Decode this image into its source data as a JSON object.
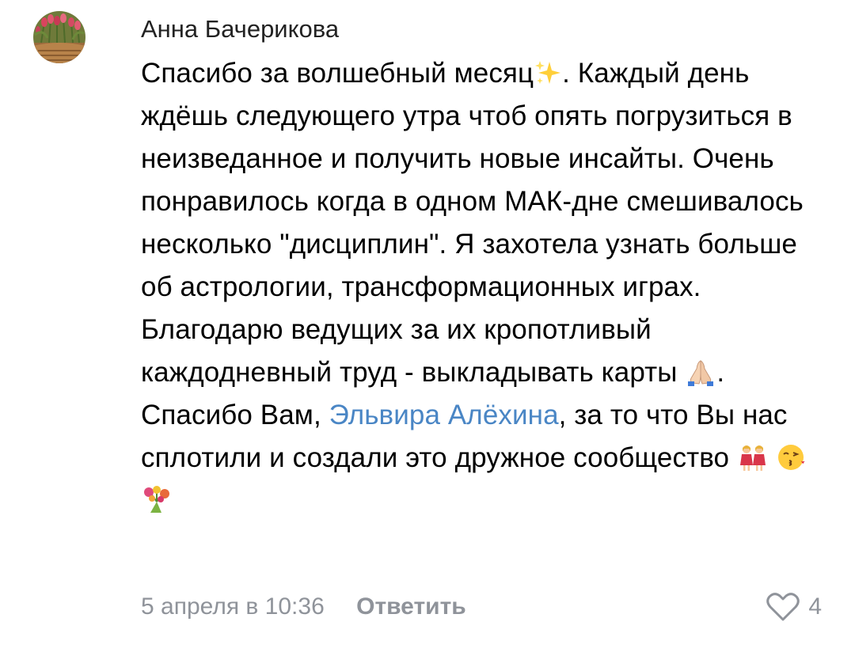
{
  "comment": {
    "author": "Анна Бачерикова",
    "avatar_icon": "tulips-avatar",
    "text": {
      "p1": "Спасибо за волшебный месяц",
      "p2": ". Каждый день ждёшь следующего утра чтоб опять погрузиться в неизведанное и получить новые инсайты. Очень понравилось когда в одном МАК-дне смешивалось несколько \"дисциплин\". Я захотела узнать больше об астрологии, трансформационных играх. Благодарю ведущих за их кропотливый каждодневный труд - выкладывать карты",
      "p3": ". Спасибо Вам,",
      "mention": "Эльвира Алёхина",
      "p4": ", за то что Вы нас сплотили и создали это дружное сообщество"
    },
    "emojis": [
      "sparkles-icon",
      "folded-hands-icon",
      "two-women-icon",
      "kiss-face-icon",
      "bouquet-icon"
    ],
    "date": "5 апреля в 10:36",
    "reply_label": "Ответить",
    "likes_count": "4",
    "like_icon": "heart-outline-icon"
  },
  "colors": {
    "text": "#000000",
    "author": "#222222",
    "mention": "#4a86c5",
    "meta": "#8f939a",
    "background": "#ffffff"
  }
}
